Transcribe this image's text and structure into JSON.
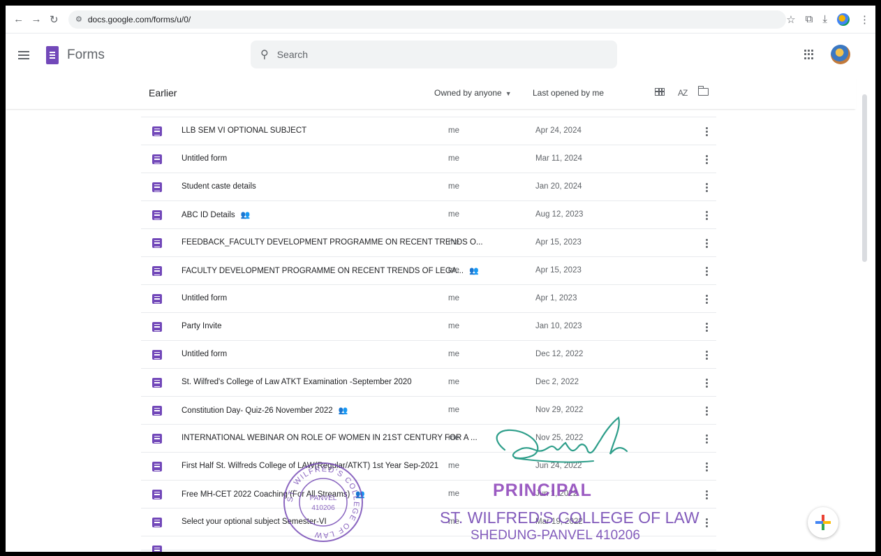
{
  "browser": {
    "url": "docs.google.com/forms/u/0/"
  },
  "app": {
    "title": "Forms",
    "search_placeholder": "Search"
  },
  "list_header": {
    "section": "Earlier",
    "owner_filter": "Owned by anyone",
    "sort": "Last opened by me",
    "sort_icon": "AZ"
  },
  "rows": [
    {
      "title": "LLB SEM VI OPTIONAL SUBJECT",
      "owner": "me",
      "date": "Apr 24, 2024",
      "shared": false
    },
    {
      "title": "Untitled form",
      "owner": "me",
      "date": "Mar 11, 2024",
      "shared": false
    },
    {
      "title": "Student caste details",
      "owner": "me",
      "date": "Jan 20, 2024",
      "shared": false
    },
    {
      "title": "ABC ID Details",
      "owner": "me",
      "date": "Aug 12, 2023",
      "shared": true
    },
    {
      "title": "FEEDBACK_FACULTY DEVELOPMENT PROGRAMME ON RECENT TRENDS O...",
      "owner": "me",
      "date": "Apr 15, 2023",
      "shared": false
    },
    {
      "title": "FACULTY DEVELOPMENT PROGRAMME ON RECENT TRENDS OF LEGA...",
      "owner": "me",
      "date": "Apr 15, 2023",
      "shared": true
    },
    {
      "title": "Untitled form",
      "owner": "me",
      "date": "Apr 1, 2023",
      "shared": false
    },
    {
      "title": "Party Invite",
      "owner": "me",
      "date": "Jan 10, 2023",
      "shared": false
    },
    {
      "title": "Untitled form",
      "owner": "me",
      "date": "Dec 12, 2022",
      "shared": false
    },
    {
      "title": "St. Wilfred's College of Law ATKT Examination -September 2020",
      "owner": "me",
      "date": "Dec 2, 2022",
      "shared": false
    },
    {
      "title": "Constitution Day- Quiz-26 November 2022",
      "owner": "me",
      "date": "Nov 29, 2022",
      "shared": true
    },
    {
      "title": "INTERNATIONAL WEBINAR ON ROLE OF WOMEN IN 21ST CENTURY FOR A ...",
      "owner": "me",
      "date": "Nov 25, 2022",
      "shared": false
    },
    {
      "title": "First Half St. Wilfreds College of LAW(Regular/ATKT) 1st Year Sep-2021",
      "owner": "me",
      "date": "Jun 24, 2022",
      "shared": false
    },
    {
      "title": "Free MH-CET 2022 Coaching (For All Streams)",
      "owner": "me",
      "date": "Jun 1, 2022",
      "shared": true
    },
    {
      "title": "Select your optional subject Semester-VI",
      "owner": "me",
      "date": "Mar 19, 2022",
      "shared": false
    }
  ],
  "stamps": {
    "seal_text": "ST. WILFRED'S COLLEGE OF LAW",
    "seal_center": "PANVEL",
    "seal_pin": "410206",
    "principal_title": "PRINCIPAL",
    "principal_line1": "ST. WILFRED'S COLLEGE OF LAW",
    "principal_line2": "SHEDUNG-PANVEL 410206"
  },
  "colors": {
    "forms_purple": "#7248b9",
    "stamp_purple": "#6d3fb0",
    "signature_green": "#2e9e8a"
  }
}
